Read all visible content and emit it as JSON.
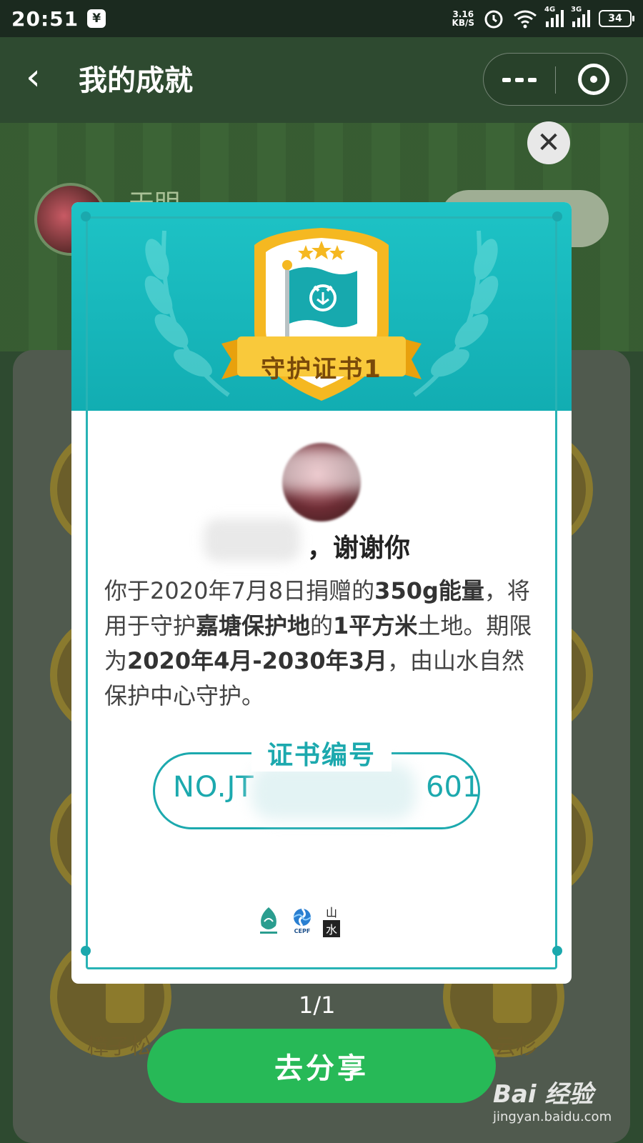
{
  "status_bar": {
    "time": "20:51",
    "yen_icon": "¥",
    "net_speed_value": "3.16",
    "net_speed_unit": "KB/S",
    "signal_1_tag": "4G",
    "signal_2_tag": "3G",
    "battery": "34"
  },
  "nav": {
    "back_icon": "‹",
    "title": "我的成就"
  },
  "background": {
    "username": "天明",
    "badge_labels": [
      "樟子松",
      "云杉"
    ]
  },
  "certificate": {
    "close_icon": "✕",
    "title": "守护证书1",
    "thanks": "，谢谢你",
    "description": {
      "part1": "你于2020年7月8日捐赠的",
      "energy": "350g能量",
      "part2": "，将用于守护",
      "location": "嘉塘保护地",
      "part3": "的",
      "area": "1平方米",
      "part4": "土地。期限为",
      "period": "2020年4月-2030年3月",
      "part5": "，由山水自然保护中心守护。"
    },
    "number_label": "证书编号",
    "number_prefix": "NO.JT",
    "number_suffix": "601",
    "logos": [
      "CEPF",
      "山",
      "水"
    ]
  },
  "pager": "1/1",
  "share_button": "去分享",
  "watermark": {
    "brand": "Bai  经验",
    "url": "jingyan.baidu.com"
  },
  "colors": {
    "teal_header": "#1ec3c6",
    "teal_text": "#1ca9ae",
    "share_green": "#27b957",
    "emblem_gold": "#f5b821"
  }
}
